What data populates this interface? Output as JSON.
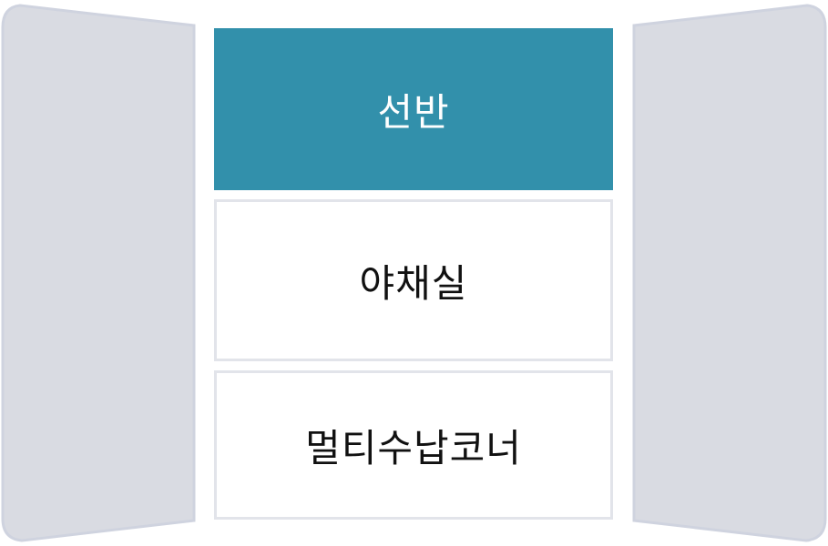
{
  "colors": {
    "accent": "#3290ab",
    "door_fill": "#d9dbe2",
    "door_stroke": "#cfd3df",
    "section_border": "#e2e4ea"
  },
  "sections": [
    {
      "label": "선반",
      "selected": true
    },
    {
      "label": "야채실",
      "selected": false
    },
    {
      "label": "멀티수납코너",
      "selected": false
    }
  ]
}
